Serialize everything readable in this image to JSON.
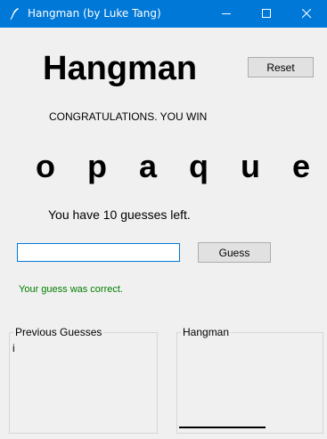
{
  "window": {
    "title": "Hangman (by Luke Tang)",
    "app_icon": "feather-icon",
    "minimize_icon": "minimize-icon",
    "maximize_icon": "maximize-icon",
    "close_icon": "close-icon",
    "titlebar_color": "#0078d7"
  },
  "header": {
    "title": "Hangman",
    "reset_label": "Reset"
  },
  "game": {
    "status": "CONGRATULATIONS. YOU WIN",
    "word_display": "o p a q u e",
    "guesses_left_text": "You have 10 guesses left.",
    "guess_input_value": "",
    "guess_button_label": "Guess",
    "feedback": "Your guess was correct.",
    "feedback_color": "#008000"
  },
  "panels": {
    "previous_guesses": {
      "label": "Previous Guesses",
      "content": "i"
    },
    "hangman": {
      "label": "Hangman"
    }
  }
}
